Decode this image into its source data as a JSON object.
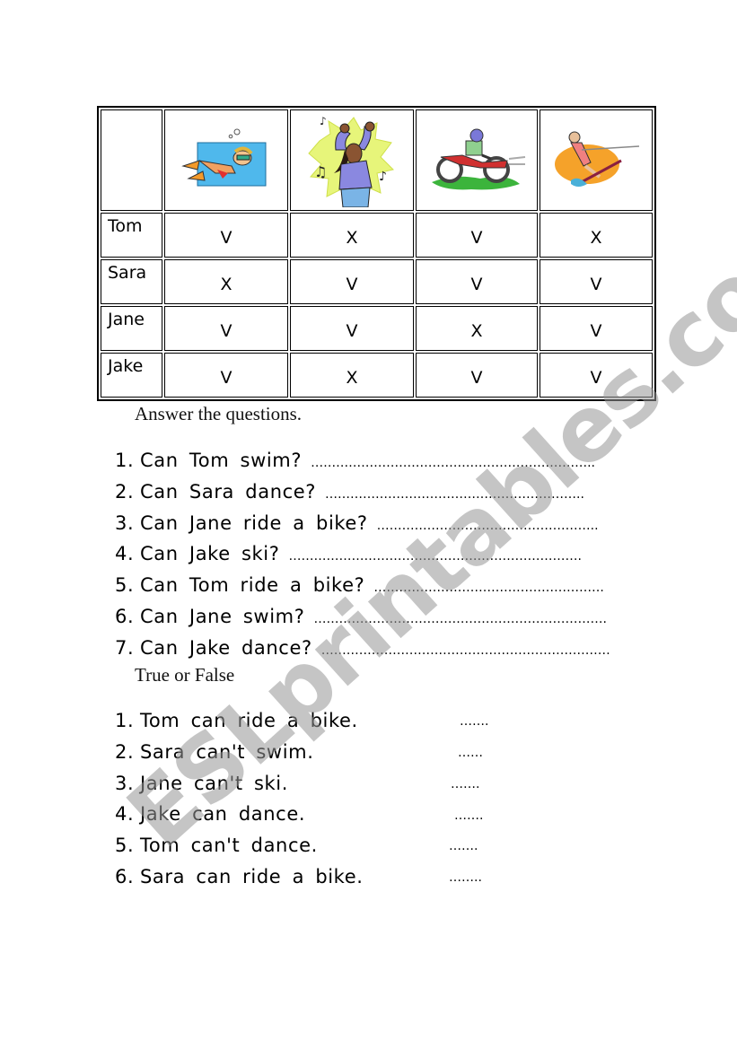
{
  "table": {
    "activities": [
      {
        "name": "swim",
        "icon": "swimmer-icon"
      },
      {
        "name": "dance",
        "icon": "dancer-icon"
      },
      {
        "name": "ride a bike",
        "icon": "bike-rider-icon"
      },
      {
        "name": "ski",
        "icon": "water-skier-icon"
      }
    ],
    "rows": [
      {
        "name": "Tom",
        "marks": [
          "V",
          "X",
          "V",
          "X"
        ]
      },
      {
        "name": "Sara",
        "marks": [
          "X",
          "V",
          "V",
          "V"
        ]
      },
      {
        "name": "Jane",
        "marks": [
          "V",
          "V",
          "X",
          "V"
        ]
      },
      {
        "name": "Jake",
        "marks": [
          "V",
          "X",
          "V",
          "V"
        ]
      }
    ]
  },
  "questions": {
    "title": "Answer the questions.",
    "items": [
      {
        "num": "1.",
        "text": "Can Tom swim?",
        "dots": "………………………………………………………….."
      },
      {
        "num": "2.",
        "text": "Can Sara dance?",
        "dots": "…………………………………………………….."
      },
      {
        "num": "3.",
        "text": "Can Jane ride a bike?",
        "dots": "…………………………………………….."
      },
      {
        "num": "4.",
        "text": "Can Jake ski?",
        "dots": "……………………………………………………………."
      },
      {
        "num": "5.",
        "text": "Can Tom ride a bike?",
        "dots": "………………………………………………."
      },
      {
        "num": "6.",
        "text": "Can Jane swim?",
        "dots": "……………………………………………………………."
      },
      {
        "num": "7.",
        "text": "Can Jake dance?",
        "dots": "……………………………………………………………"
      }
    ]
  },
  "true_false": {
    "title": "True or False",
    "items": [
      {
        "num": "1.",
        "text": "Tom can ride a bike.",
        "dots": "……."
      },
      {
        "num": "2.",
        "text": "Sara can't swim.",
        "dots": "……"
      },
      {
        "num": "3.",
        "text": "Jane can't ski.",
        "dots": "……."
      },
      {
        "num": "4.",
        "text": "Jake can dance.",
        "dots": "……."
      },
      {
        "num": "5.",
        "text": "Tom can't dance.",
        "dots": "……."
      },
      {
        "num": "6.",
        "text": "Sara can ride a bike.",
        "dots": "…….."
      }
    ]
  },
  "watermark": "ESLprintables.com"
}
